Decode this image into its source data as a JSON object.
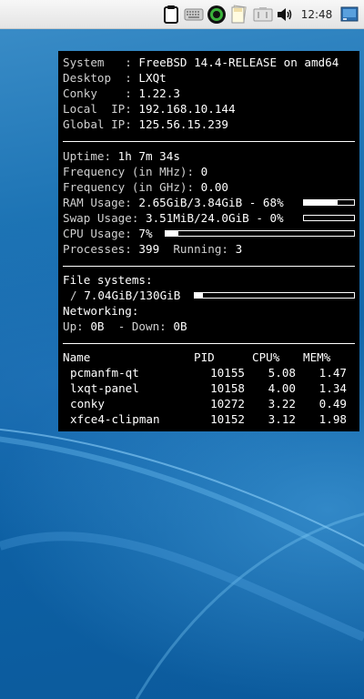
{
  "panel": {
    "clock": "12:48",
    "icons": [
      "clipboard-icon",
      "keyboard-icon",
      "status-ring-icon",
      "notes-icon",
      "battery-icon",
      "volume-icon",
      "show-desktop-icon"
    ]
  },
  "conky": {
    "system": {
      "label": "System   :",
      "value": "FreeBSD 14.4-RELEASE on amd64"
    },
    "desktop": {
      "label": "Desktop  :",
      "value": "LXQt"
    },
    "conky_version": {
      "label": "Conky    :",
      "value": "1.22.3"
    },
    "local_ip": {
      "label": "Local  IP:",
      "value": "192.168.10.144"
    },
    "global_ip": {
      "label": "Global IP:",
      "value": "125.56.15.239"
    },
    "uptime": {
      "label": "Uptime:",
      "value": "1h 7m 34s"
    },
    "freq_mhz": {
      "label": "Frequency (in MHz):",
      "value": "0"
    },
    "freq_ghz": {
      "label": "Frequency (in GHz):",
      "value": "0.00"
    },
    "ram": {
      "label": "RAM Usage:",
      "value": "2.65GiB/3.84GiB - 68%",
      "percent": 68
    },
    "swap": {
      "label": "Swap Usage:",
      "value": "3.51MiB/24.0GiB - 0%",
      "percent": 0
    },
    "cpu": {
      "label": "CPU Usage:",
      "value": "7%",
      "percent": 7
    },
    "processes": {
      "label": "Processes:",
      "value": "399",
      "running_label": "Running:",
      "running_value": "3"
    },
    "filesystems": {
      "label": "File systems:",
      "root_label": "/",
      "root_value": "7.04GiB/130GiB",
      "percent": 5.4
    },
    "networking": {
      "label": "Networking:",
      "up_label": "Up:",
      "up_value": "0B",
      "down_label": "- Down:",
      "down_value": "0B"
    },
    "process_table": {
      "headers": {
        "name": "Name",
        "pid": "PID",
        "cpu": "CPU%",
        "mem": "MEM%"
      },
      "rows": [
        {
          "name": "pcmanfm-qt",
          "pid": "10155",
          "cpu": "5.08",
          "mem": "1.47"
        },
        {
          "name": "lxqt-panel",
          "pid": "10158",
          "cpu": "4.00",
          "mem": "1.34"
        },
        {
          "name": "conky",
          "pid": "10272",
          "cpu": "3.22",
          "mem": "0.49"
        },
        {
          "name": "xfce4-clipman",
          "pid": "10152",
          "cpu": "3.12",
          "mem": "1.98"
        }
      ]
    }
  }
}
